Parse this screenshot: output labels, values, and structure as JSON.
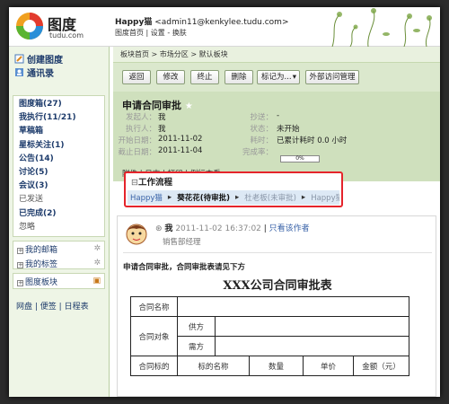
{
  "brand": {
    "name": "图度",
    "sub": "tudu.com"
  },
  "user": {
    "name": "Happy猫",
    "email": "<admin11@kenkylee.tudu.com>"
  },
  "links": [
    "图度首页",
    "设置",
    "换肤"
  ],
  "sidebar": {
    "create": "创建图度",
    "contacts": "通讯录",
    "items": [
      {
        "label": "图度箱(27)",
        "light": false
      },
      {
        "label": "我执行(11/21)",
        "light": false
      },
      {
        "label": "草稿箱",
        "light": false
      },
      {
        "label": "星标关注(1)",
        "light": false
      },
      {
        "label": "公告(14)",
        "light": false
      },
      {
        "label": "讨论(5)",
        "light": false
      },
      {
        "label": "会议(3)",
        "light": false
      },
      {
        "label": "已发送",
        "light": true
      },
      {
        "label": "已完成(2)",
        "light": false
      },
      {
        "label": "忽略",
        "light": true
      }
    ],
    "mailbox": "我的邮箱",
    "tags": "我的标签",
    "board": "图度板块",
    "tools": [
      "网盘",
      "便签",
      "日程表"
    ]
  },
  "breadcrumb": "板块首页 > 市场分区 > 默认板块",
  "toolbar": {
    "back": "返回",
    "edit": "修改",
    "stop": "终止",
    "delete": "删除",
    "mark": "标记为...",
    "external": "外部访问管理"
  },
  "detail": {
    "title": "申请合同审批",
    "fields_left": [
      {
        "label": "发起人：",
        "value": "我"
      },
      {
        "label": "执行人：",
        "value": "我"
      },
      {
        "label": "开始日期：",
        "value": "2011-11-02"
      },
      {
        "label": "截止日期：",
        "value": "2011-11-04"
      }
    ],
    "fields_right": [
      {
        "label": "抄送：",
        "value": "-"
      },
      {
        "label": "状态：",
        "value": "未开始"
      },
      {
        "label": "耗时：",
        "value": "已累计耗时 0.0 小时"
      },
      {
        "label": "完成率：",
        "value": ""
      }
    ],
    "progress": "0%",
    "links": "附件 | 日志 | 打印 | 例行查看"
  },
  "workflow": {
    "title": "工作流程",
    "steps": [
      {
        "text": "Happy猫",
        "color": "#3a63a8",
        "bold": false
      },
      {
        "text": "▸",
        "color": "#333",
        "bold": false
      },
      {
        "text": "葵花花(待审批)",
        "color": "#111",
        "bold": true
      },
      {
        "text": "▸",
        "color": "#333",
        "bold": false
      },
      {
        "text": "杜老板(未审批)",
        "color": "#8a96a8",
        "bold": false
      },
      {
        "text": "▸",
        "color": "#333",
        "bold": false
      },
      {
        "text": "Happy猫",
        "color": "#8a96a8",
        "bold": false
      }
    ]
  },
  "post": {
    "author": "我",
    "time": "2011-11-02 16:37:02",
    "readonly": "只看该作者",
    "role": "销售部经理",
    "body": "申请合同审批，合同审批表请见下方",
    "doc_title": "XXX公司合同审批表",
    "table": {
      "name": "合同名称",
      "target": "合同对象",
      "supplier": "供方",
      "buyer": "需方",
      "subject": "合同标的",
      "cols": [
        "标的名称",
        "数量",
        "单价",
        "金额（元）"
      ]
    }
  }
}
